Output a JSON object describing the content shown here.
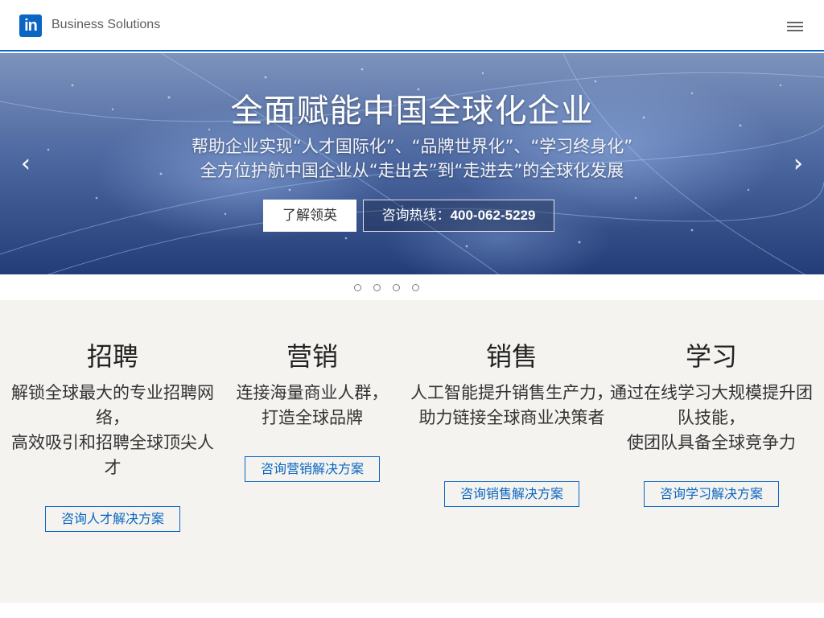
{
  "header": {
    "logo_text": "in",
    "brand": "Business Solutions",
    "menu_icon": "hamburger-menu-icon",
    "accent_color": "#0a66c2"
  },
  "hero": {
    "title": "全面赋能中国全球化企业",
    "subtitle_line1": "帮助企业实现“人才国际化”、“品牌世界化”、“学习终身化”",
    "subtitle_line2": "全方位护航中国企业从“走出去”到“走进去”的全球化发展",
    "learn_button": "了解领英",
    "hotline_label": "咨询热线：",
    "hotline_number": "400-062-5229",
    "prev_arrow": "‹",
    "next_arrow": "›",
    "slide_count": 4,
    "active_slide": 1
  },
  "solutions": [
    {
      "title": "招聘",
      "desc_lines": [
        "解锁全球最大的专业招聘网络，",
        "高效吸引和招聘全球顶尖人才"
      ],
      "button": "咨询人才解决方案"
    },
    {
      "title": "营销",
      "desc_lines": [
        "连接海量商业人群，",
        "打造全球品牌"
      ],
      "button": "咨询营销解决方案"
    },
    {
      "title": "销售",
      "desc_lines": [
        "人工智能提升销售生产力，",
        "助力链接全球商业决策者"
      ],
      "button": "咨询销售解决方案"
    },
    {
      "title": "学习",
      "desc_lines": [
        "通过在线学习大规模提升团队技能，",
        "使团队具备全球竞争力"
      ],
      "button": "咨询学习解决方案"
    }
  ]
}
